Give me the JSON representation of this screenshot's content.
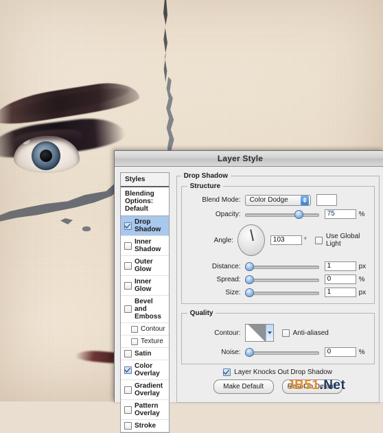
{
  "window": {
    "title": "Layer Style"
  },
  "watermark": {
    "part1": "JB51",
    "part2": ".Net",
    "color1": "#e08a2e",
    "color2": "#203a63"
  },
  "styles_panel": {
    "header": "Styles",
    "blending_options": "Blending Options: Default",
    "effects": [
      {
        "label": "Drop Shadow",
        "checked": true,
        "selected": true,
        "indented": false
      },
      {
        "label": "Inner Shadow",
        "checked": false,
        "selected": false,
        "indented": false
      },
      {
        "label": "Outer Glow",
        "checked": false,
        "selected": false,
        "indented": false
      },
      {
        "label": "Inner Glow",
        "checked": false,
        "selected": false,
        "indented": false
      },
      {
        "label": "Bevel and Emboss",
        "checked": false,
        "selected": false,
        "indented": false
      },
      {
        "label": "Contour",
        "checked": false,
        "selected": false,
        "indented": true
      },
      {
        "label": "Texture",
        "checked": false,
        "selected": false,
        "indented": true
      },
      {
        "label": "Satin",
        "checked": false,
        "selected": false,
        "indented": false
      },
      {
        "label": "Color Overlay",
        "checked": true,
        "selected": false,
        "indented": false
      },
      {
        "label": "Gradient Overlay",
        "checked": false,
        "selected": false,
        "indented": false
      },
      {
        "label": "Pattern Overlay",
        "checked": false,
        "selected": false,
        "indented": false
      },
      {
        "label": "Stroke",
        "checked": false,
        "selected": false,
        "indented": false
      }
    ]
  },
  "drop_shadow": {
    "group_title": "Drop Shadow",
    "structure": {
      "title": "Structure",
      "blend_mode_label": "Blend Mode:",
      "blend_mode_value": "Color Dodge",
      "shadow_color": "#ffffff",
      "opacity_label": "Opacity:",
      "opacity_value": "75",
      "opacity_unit": "%",
      "angle_label": "Angle:",
      "angle_value": "103",
      "angle_unit": "°",
      "use_global_light_label": "Use Global Light",
      "use_global_light_checked": false,
      "distance_label": "Distance:",
      "distance_value": "1",
      "distance_unit": "px",
      "spread_label": "Spread:",
      "spread_value": "0",
      "spread_unit": "%",
      "size_label": "Size:",
      "size_value": "1",
      "size_unit": "px"
    },
    "quality": {
      "title": "Quality",
      "contour_label": "Contour:",
      "anti_aliased_label": "Anti-aliased",
      "anti_aliased_checked": false,
      "noise_label": "Noise:",
      "noise_value": "0",
      "noise_unit": "%"
    },
    "footer": {
      "knockout_label": "Layer Knocks Out Drop Shadow",
      "knockout_checked": true,
      "make_default": "Make Default",
      "reset_to_default": "Reset to Default"
    }
  }
}
